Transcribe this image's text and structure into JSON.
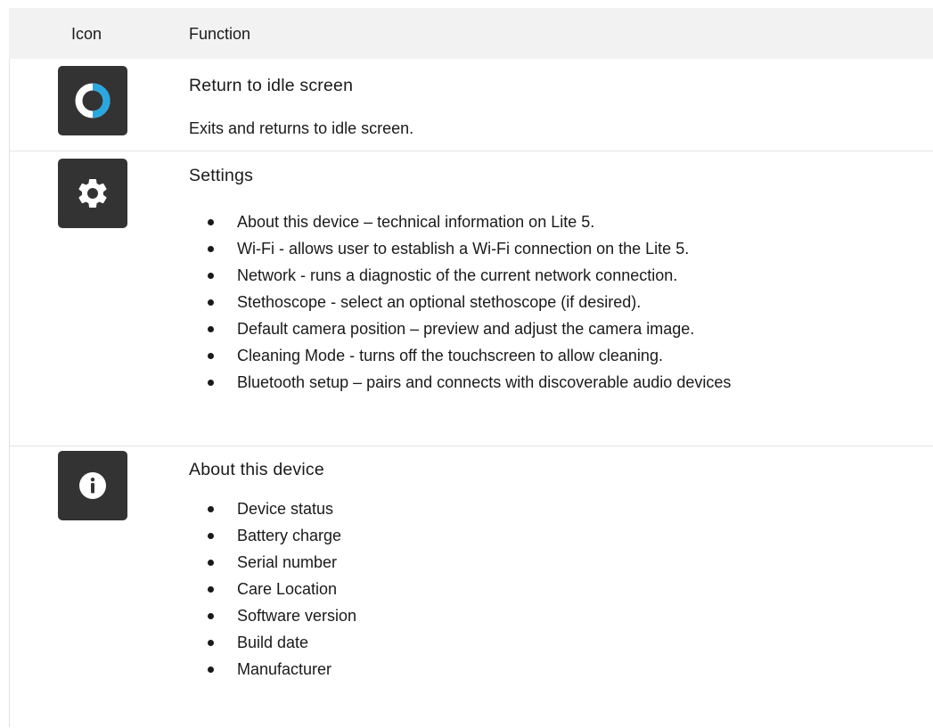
{
  "table": {
    "headers": {
      "icon": "Icon",
      "function": "Function"
    },
    "rows": [
      {
        "icon": "idle-screen-ring-icon",
        "title": "Return to idle screen",
        "description": "Exits and returns to idle screen."
      },
      {
        "icon": "gear-icon",
        "title": "Settings",
        "items": [
          "About this device – technical information on Lite 5.",
          "Wi-Fi - allows user to establish a Wi-Fi connection on the Lite 5.",
          "Network - runs a diagnostic of the current network connection.",
          "Stethoscope - select an optional stethoscope (if desired).",
          "Default camera position – preview and adjust the camera image.",
          "Cleaning Mode - turns off the touchscreen to allow cleaning.",
          "Bluetooth setup – pairs and connects with discoverable audio devices"
        ]
      },
      {
        "icon": "info-icon",
        "title": "About this device",
        "items": [
          "Device status",
          "Battery charge",
          "Serial number",
          "Care Location",
          "Software version",
          "Build date",
          "Manufacturer"
        ]
      }
    ]
  },
  "colors": {
    "tile": "#333333",
    "accent_blue": "#29a8e0",
    "header_bg": "#f2f2f2",
    "divider": "#e3e3e3"
  }
}
